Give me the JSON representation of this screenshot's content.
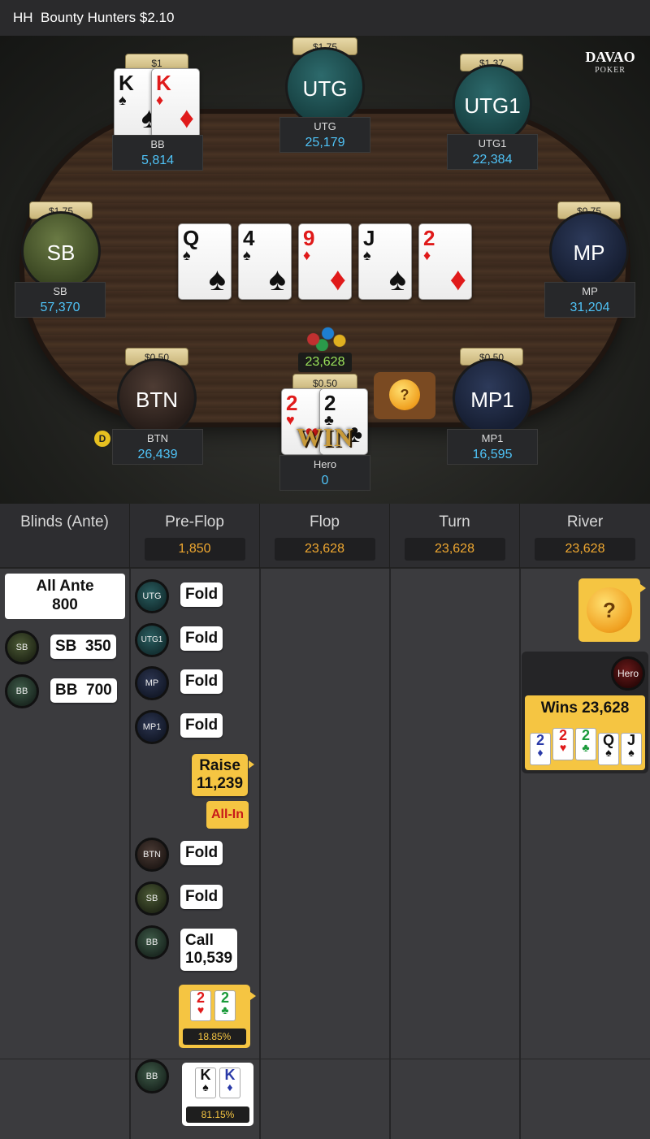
{
  "titlebar": {
    "title": "HH  Bounty Hunters $2.10"
  },
  "brand": {
    "name": "DAVAO",
    "sub": "POKER"
  },
  "colors": {
    "accent": "#f5c542",
    "stack": "#4fc3f7",
    "pot": "#9be35a",
    "street_pot": "#f0a830"
  },
  "seats": {
    "bb": {
      "bet": "$1",
      "name": "BB",
      "stack": "5,814",
      "cards": [
        {
          "rank": "K",
          "suit": "♠"
        },
        {
          "rank": "K",
          "suit": "♦"
        }
      ]
    },
    "utg": {
      "bet": "$1.75",
      "avatar": "UTG",
      "name": "UTG",
      "stack": "25,179"
    },
    "utg1": {
      "bet": "$1.37",
      "avatar": "UTG1",
      "name": "UTG1",
      "stack": "22,384"
    },
    "sb": {
      "bet": "$1.75",
      "avatar": "SB",
      "name": "SB",
      "stack": "57,370"
    },
    "mp": {
      "bet": "$0.75",
      "avatar": "MP",
      "name": "MP",
      "stack": "31,204"
    },
    "btn": {
      "bet": "$0.50",
      "avatar": "BTN",
      "name": "BTN",
      "stack": "26,439",
      "dealer": "D"
    },
    "mp1": {
      "bet": "$0.50",
      "avatar": "MP1",
      "name": "MP1",
      "stack": "16,595"
    },
    "hero": {
      "bet": "$0.50",
      "name": "Hero",
      "stack": "0",
      "result": "WIN",
      "cards": [
        {
          "rank": "2",
          "suit": "♥"
        },
        {
          "rank": "2",
          "suit": "♣"
        }
      ]
    }
  },
  "board": [
    {
      "rank": "Q",
      "suit": "♠"
    },
    {
      "rank": "4",
      "suit": "♠"
    },
    {
      "rank": "9",
      "suit": "♦"
    },
    {
      "rank": "J",
      "suit": "♠"
    },
    {
      "rank": "2",
      "suit": "♦"
    }
  ],
  "pot": "23,628",
  "streets": [
    {
      "label": "Blinds (Ante)",
      "pot": ""
    },
    {
      "label": "Pre-Flop",
      "pot": "1,850"
    },
    {
      "label": "Flop",
      "pot": "23,628"
    },
    {
      "label": "Turn",
      "pot": "23,628"
    },
    {
      "label": "River",
      "pot": "23,628"
    }
  ],
  "blinds": {
    "ante_label": "All Ante",
    "ante_value": "800",
    "sb": {
      "pos": "SB",
      "text": "SB  350"
    },
    "bb": {
      "pos": "BB",
      "text": "BB  700"
    }
  },
  "preflop": [
    {
      "pos": "UTG",
      "action": "Fold"
    },
    {
      "pos": "UTG1",
      "action": "Fold"
    },
    {
      "pos": "MP",
      "action": "Fold"
    },
    {
      "pos": "MP1",
      "action": "Fold"
    },
    {
      "pos": "BTN",
      "action": "Fold"
    },
    {
      "pos": "SB",
      "action": "Fold"
    },
    {
      "pos": "BB",
      "action": "Call",
      "amount": "10,539"
    }
  ],
  "hero_action": {
    "action": "Raise",
    "amount": "11,239",
    "tag": "All-In"
  },
  "hero_hand": {
    "cards": [
      {
        "rank": "2",
        "suit": "♥"
      },
      {
        "rank": "2",
        "suit": "♣"
      }
    ],
    "equity": "18.85%"
  },
  "bb_hand": {
    "pos": "BB",
    "cards": [
      {
        "rank": "K",
        "suit": "♠"
      },
      {
        "rank": "K",
        "suit": "♦"
      }
    ],
    "equity": "81.15%"
  },
  "river_result": {
    "player": "Hero",
    "text": "Wins 23,628",
    "cards": [
      {
        "rank": "2",
        "suit": "♦"
      },
      {
        "rank": "2",
        "suit": "♥"
      },
      {
        "rank": "2",
        "suit": "♣"
      },
      {
        "rank": "Q",
        "suit": "♠"
      },
      {
        "rank": "J",
        "suit": "♠"
      }
    ]
  }
}
